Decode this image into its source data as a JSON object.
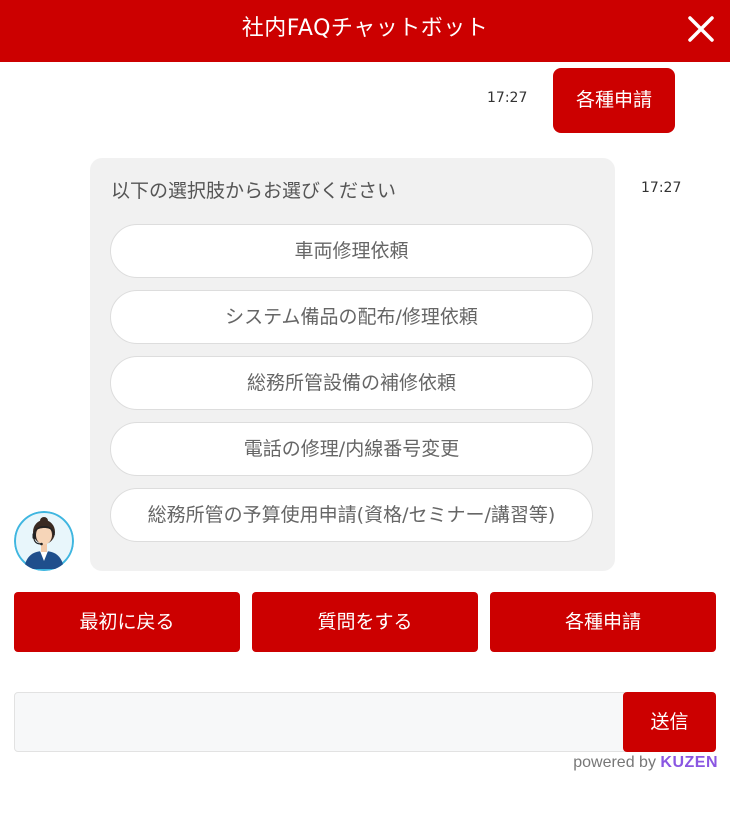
{
  "header": {
    "title": "社内FAQチャットボット",
    "close_icon": "close-icon"
  },
  "conversation": {
    "user_message": {
      "text": "各種申請",
      "time": "17:27"
    },
    "bot_message": {
      "time": "17:27",
      "prompt": "以下の選択肢からお選びください",
      "options": [
        "車両修理依頼",
        "システム備品の配布/修理依頼",
        "総務所管設備の補修依頼",
        "電話の修理/内線番号変更",
        "総務所管の予算使用申請(資格/セミナー/講習等)"
      ],
      "avatar_icon": "operator-avatar-icon"
    }
  },
  "actions": [
    "最初に戻る",
    "質問をする",
    "各種申請"
  ],
  "composer": {
    "input_value": "",
    "input_placeholder": "",
    "send_label": "送信"
  },
  "footer": {
    "powered_prefix": "powered by",
    "powered_brand": "KUZEN"
  },
  "colors": {
    "accent": "#cc0000",
    "card_background": "#f1f1f1",
    "brand": "#8a56e2"
  }
}
